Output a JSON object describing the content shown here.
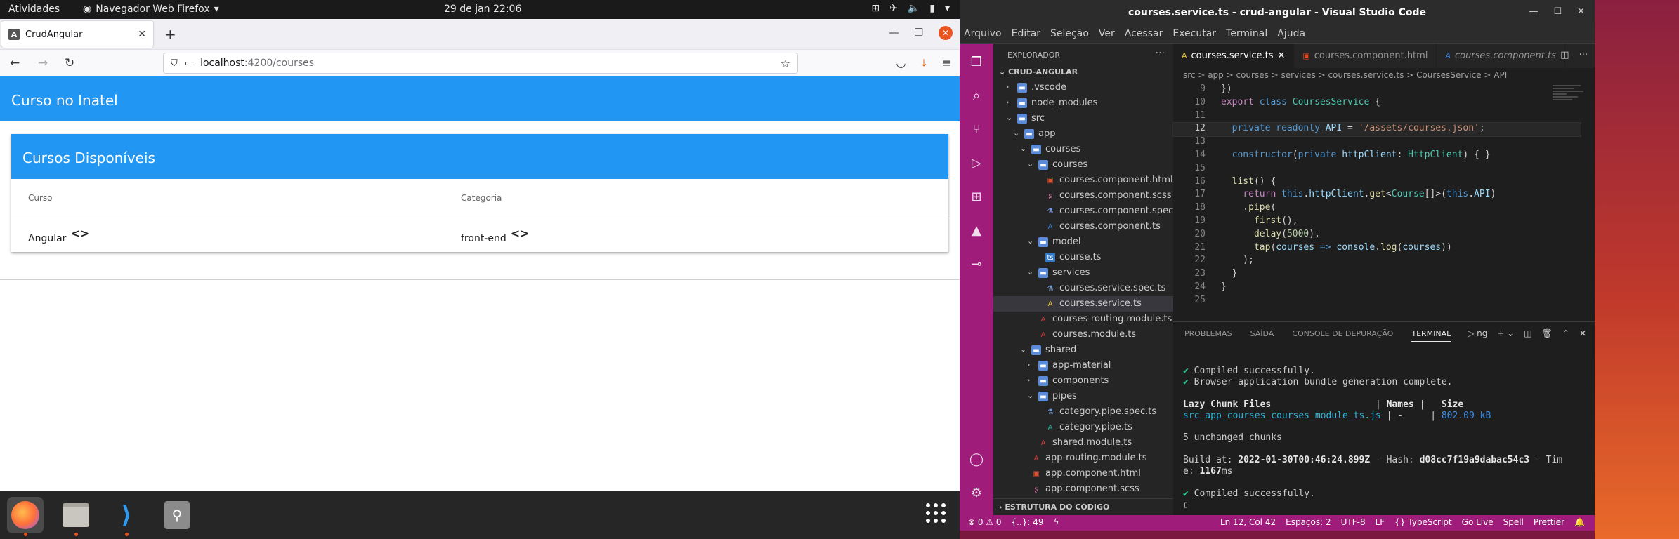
{
  "gnome": {
    "activities": "Atividades",
    "app_name": "Navegador Web Firefox",
    "clock": "29 de jan  22:06"
  },
  "firefox": {
    "tab_title": "CrudAngular",
    "url_host": "localhost",
    "url_path": ":4200/courses"
  },
  "page": {
    "toolbar_title": "Curso no Inatel",
    "card_title": "Cursos Disponíveis",
    "columns": [
      "Curso",
      "Categoria"
    ],
    "rows": [
      {
        "curso": "Angular",
        "categoria": "front-end"
      }
    ]
  },
  "vscode": {
    "window_title": "courses.service.ts - crud-angular - Visual Studio Code",
    "menu": [
      "Arquivo",
      "Editar",
      "Seleção",
      "Ver",
      "Acessar",
      "Executar",
      "Terminal",
      "Ajuda"
    ],
    "explorer_title": "EXPLORADOR",
    "project": "CRUD-ANGULAR",
    "tree": [
      {
        "label": ".vscode",
        "type": "folder",
        "depth": 1,
        "open": false
      },
      {
        "label": "node_modules",
        "type": "folder",
        "depth": 1,
        "open": false
      },
      {
        "label": "src",
        "type": "folder",
        "depth": 1,
        "open": true
      },
      {
        "label": "app",
        "type": "folder",
        "depth": 2,
        "open": true
      },
      {
        "label": "courses",
        "type": "folder",
        "depth": 3,
        "open": true
      },
      {
        "label": "courses",
        "type": "folder",
        "depth": 4,
        "open": true
      },
      {
        "label": "courses.component.html",
        "type": "html",
        "depth": 5
      },
      {
        "label": "courses.component.scss",
        "type": "scss",
        "depth": 5
      },
      {
        "label": "courses.component.spec.ts",
        "type": "spec",
        "depth": 5
      },
      {
        "label": "courses.component.ts",
        "type": "ts",
        "depth": 5
      },
      {
        "label": "model",
        "type": "folder",
        "depth": 4,
        "open": true
      },
      {
        "label": "course.ts",
        "type": "tsfile",
        "depth": 5
      },
      {
        "label": "services",
        "type": "folder",
        "depth": 4,
        "open": true
      },
      {
        "label": "courses.service.spec.ts",
        "type": "spec",
        "depth": 5
      },
      {
        "label": "courses.service.ts",
        "type": "service",
        "depth": 5,
        "selected": true
      },
      {
        "label": "courses-routing.module.ts",
        "type": "module",
        "depth": 4
      },
      {
        "label": "courses.module.ts",
        "type": "module",
        "depth": 4
      },
      {
        "label": "shared",
        "type": "folder",
        "depth": 3,
        "open": true
      },
      {
        "label": "app-material",
        "type": "folder",
        "depth": 4,
        "open": false
      },
      {
        "label": "components",
        "type": "folder",
        "depth": 4,
        "open": false
      },
      {
        "label": "pipes",
        "type": "folder",
        "depth": 4,
        "open": true
      },
      {
        "label": "category.pipe.spec.ts",
        "type": "spec",
        "depth": 5
      },
      {
        "label": "category.pipe.ts",
        "type": "pipe",
        "depth": 5
      },
      {
        "label": "shared.module.ts",
        "type": "module",
        "depth": 4
      },
      {
        "label": "app-routing.module.ts",
        "type": "module",
        "depth": 3
      },
      {
        "label": "app.component.html",
        "type": "html",
        "depth": 3
      },
      {
        "label": "app.component.scss",
        "type": "scss",
        "depth": 3
      }
    ],
    "outline_title": "ESTRUTURA DO CÓDIGO",
    "tabs": [
      {
        "label": "courses.service.ts",
        "active": true
      },
      {
        "label": "courses.component.html",
        "active": false
      },
      {
        "label": "courses.component.ts",
        "active": false
      }
    ],
    "breadcrumb": "src > app > courses > services > courses.service.ts > CoursesService > API",
    "code_line_numbers": [
      "9",
      "10",
      "11",
      "12",
      "13",
      "14",
      "15",
      "16",
      "17",
      "18",
      "19",
      "20",
      "21",
      "22",
      "23",
      "24",
      "25"
    ],
    "panel_tabs": [
      "PROBLEMAS",
      "SAÍDA",
      "CONSOLE DE DEPURAÇÃO",
      "TERMINAL"
    ],
    "terminal_shell": "ng",
    "status_left": [
      "⊗ 0 ⚠ 0",
      "{..}: 49"
    ],
    "status_right": [
      "Ln 12, Col 42",
      "Espaços: 2",
      "UTF-8",
      "LF",
      "{} TypeScript",
      "Go Live",
      "Spell",
      "Prettier"
    ]
  }
}
